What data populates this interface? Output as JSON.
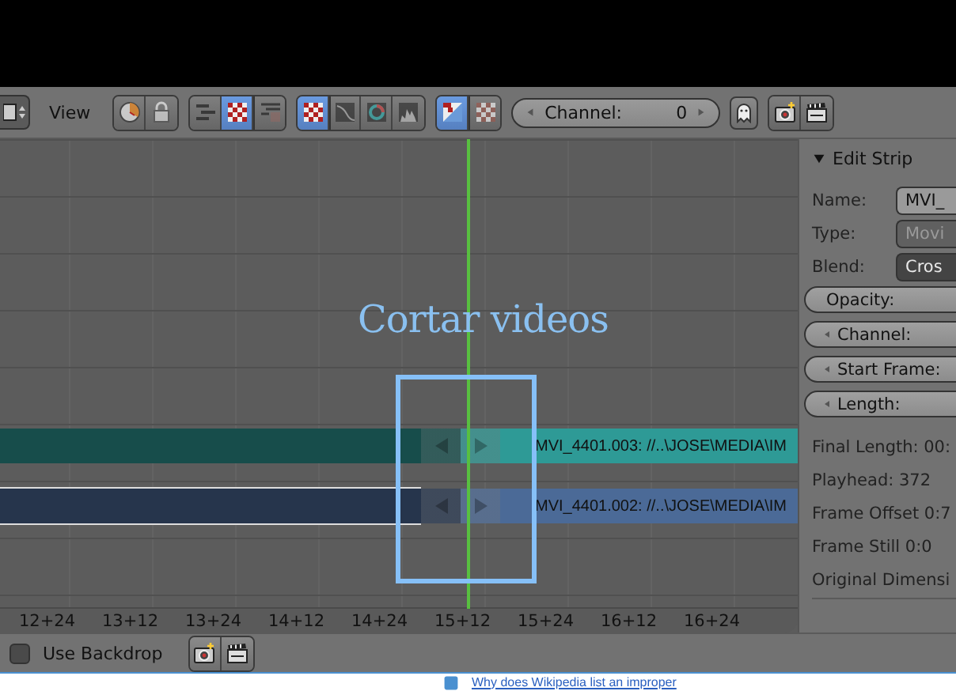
{
  "header": {
    "menu": "View",
    "groups": [
      {
        "buttons": [
          {
            "kind": "clock",
            "selected": false
          },
          {
            "kind": "lock",
            "selected": false
          }
        ]
      },
      {
        "buttons": [
          {
            "kind": "lines",
            "selected": false
          },
          {
            "kind": "checker",
            "selected": true
          },
          {
            "kind": "checker-lines",
            "selected": false
          }
        ]
      },
      {
        "buttons": [
          {
            "kind": "checker",
            "selected": true
          },
          {
            "kind": "curve",
            "selected": false
          },
          {
            "kind": "ring",
            "selected": false
          },
          {
            "kind": "histogram",
            "selected": false
          }
        ]
      },
      {
        "buttons": [
          {
            "kind": "split",
            "selected": true
          },
          {
            "kind": "checker-small",
            "selected": false
          }
        ]
      }
    ],
    "channel": {
      "label": "Channel:",
      "value": "0"
    }
  },
  "timeline": {
    "title": "Cortar videos",
    "strips": [
      {
        "label": "MVI_4401.003: //..\\JOSE\\MEDIA\\IM",
        "color": "#2e9a96",
        "selected": false
      },
      {
        "label": "MVI_4401.002: //..\\JOSE\\MEDIA\\IM",
        "color": "#4b6a97",
        "selected": true
      }
    ],
    "ruler": [
      "12+24",
      "13+12",
      "13+24",
      "14+12",
      "14+24",
      "15+12",
      "15+24",
      "16+12",
      "16+24"
    ]
  },
  "panel": {
    "title": "Edit Strip",
    "expanded": true,
    "fields": [
      {
        "kind": "text",
        "label": "Name:",
        "value": "MVI_"
      },
      {
        "kind": "menu",
        "label": "Type:",
        "value": "Movi",
        "disabled": true
      },
      {
        "kind": "menu",
        "label": "Blend:",
        "value": "Cros",
        "disabled": false
      },
      {
        "kind": "plain",
        "label": "Opacity:"
      },
      {
        "kind": "number",
        "label": "Channel:"
      },
      {
        "kind": "number",
        "label": "Start Frame:"
      },
      {
        "kind": "number",
        "label": "Length:"
      }
    ],
    "info": [
      "Final Length: 00:",
      "Playhead: 372",
      "Frame Offset 0:7",
      "Frame Still 0:0",
      "Original Dimensi"
    ]
  },
  "footer": {
    "backdrop": {
      "label": "Use Backdrop",
      "checked": false
    }
  },
  "page_link": "Why does Wikipedia list an improper"
}
